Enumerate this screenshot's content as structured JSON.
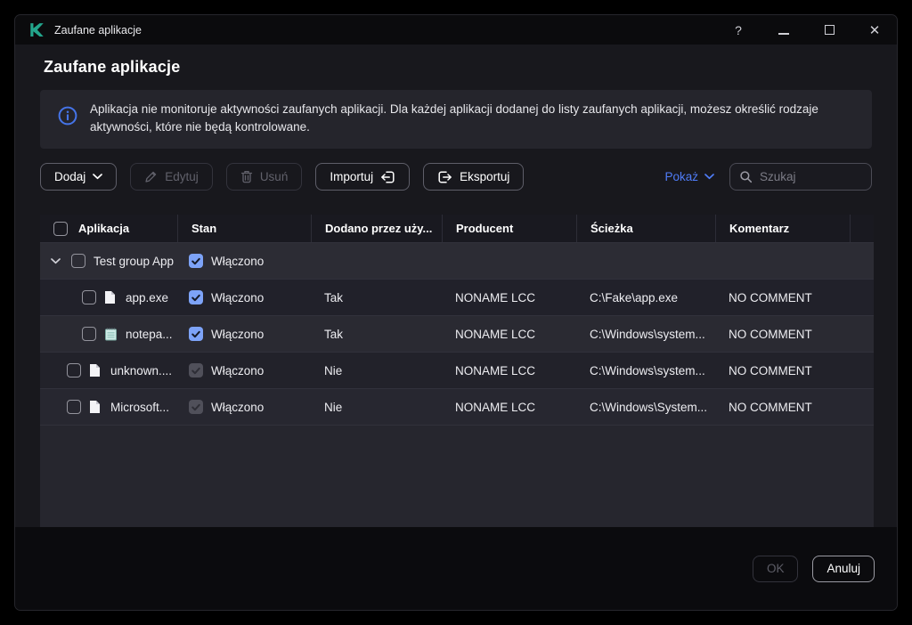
{
  "titlebar": {
    "app_title": "Zaufane aplikacje",
    "help_glyph": "?",
    "close_glyph": "✕"
  },
  "page": {
    "title": "Zaufane aplikacje"
  },
  "banner": {
    "text": "Aplikacja nie monitoruje aktywności zaufanych aplikacji. Dla każdej aplikacji dodanej do listy zaufanych aplikacji, możesz określić rodzaje aktywności, które nie będą kontrolowane."
  },
  "toolbar": {
    "add": "Dodaj",
    "edit": "Edytuj",
    "delete": "Usuń",
    "import": "Importuj",
    "export": "Eksportuj",
    "show": "Pokaż",
    "search_placeholder": "Szukaj"
  },
  "table": {
    "columns": {
      "application": "Aplikacja",
      "state": "Stan",
      "added_by_user": "Dodano przez uży...",
      "vendor": "Producent",
      "path": "Ścieżka",
      "comment": "Komentarz"
    },
    "rows": [
      {
        "kind": "group",
        "name": "Test group App",
        "state": "Włączono",
        "state_checked": true,
        "state_enabled": true,
        "selected": false,
        "expanded": true
      },
      {
        "kind": "child",
        "name": "app.exe",
        "state": "Włączono",
        "state_checked": true,
        "state_enabled": true,
        "selected": false,
        "added": "Tak",
        "vendor": "NONAME LCC",
        "path": "C:\\Fake\\app.exe",
        "comment": "NO COMMENT"
      },
      {
        "kind": "child",
        "name": "notepa...",
        "state": "Włączono",
        "state_checked": true,
        "state_enabled": true,
        "selected": false,
        "added": "Tak",
        "vendor": "NONAME LCC",
        "path": "C:\\Windows\\system...",
        "comment": "NO COMMENT"
      },
      {
        "kind": "top",
        "name": "unknown....",
        "state": "Włączono",
        "state_checked": true,
        "state_enabled": false,
        "selected": false,
        "added": "Nie",
        "vendor": "NONAME LCC",
        "path": "C:\\Windows\\system...",
        "comment": "NO COMMENT"
      },
      {
        "kind": "top",
        "name": "Microsoft...",
        "state": "Włączono",
        "state_checked": true,
        "state_enabled": false,
        "selected": false,
        "added": "Nie",
        "vendor": "NONAME LCC",
        "path": "C:\\Windows\\System...",
        "comment": "NO COMMENT"
      }
    ]
  },
  "footer": {
    "ok": "OK",
    "cancel": "Anuluj"
  },
  "colors": {
    "brand_teal": "#23a68c",
    "accent_checkbox_blue": "#7da3f8",
    "link_blue": "#4f7cf7",
    "info_icon_blue": "#4574e8",
    "window_bg": "#18181d",
    "banner_bg": "#25252c",
    "row_bg": "#24242c"
  }
}
